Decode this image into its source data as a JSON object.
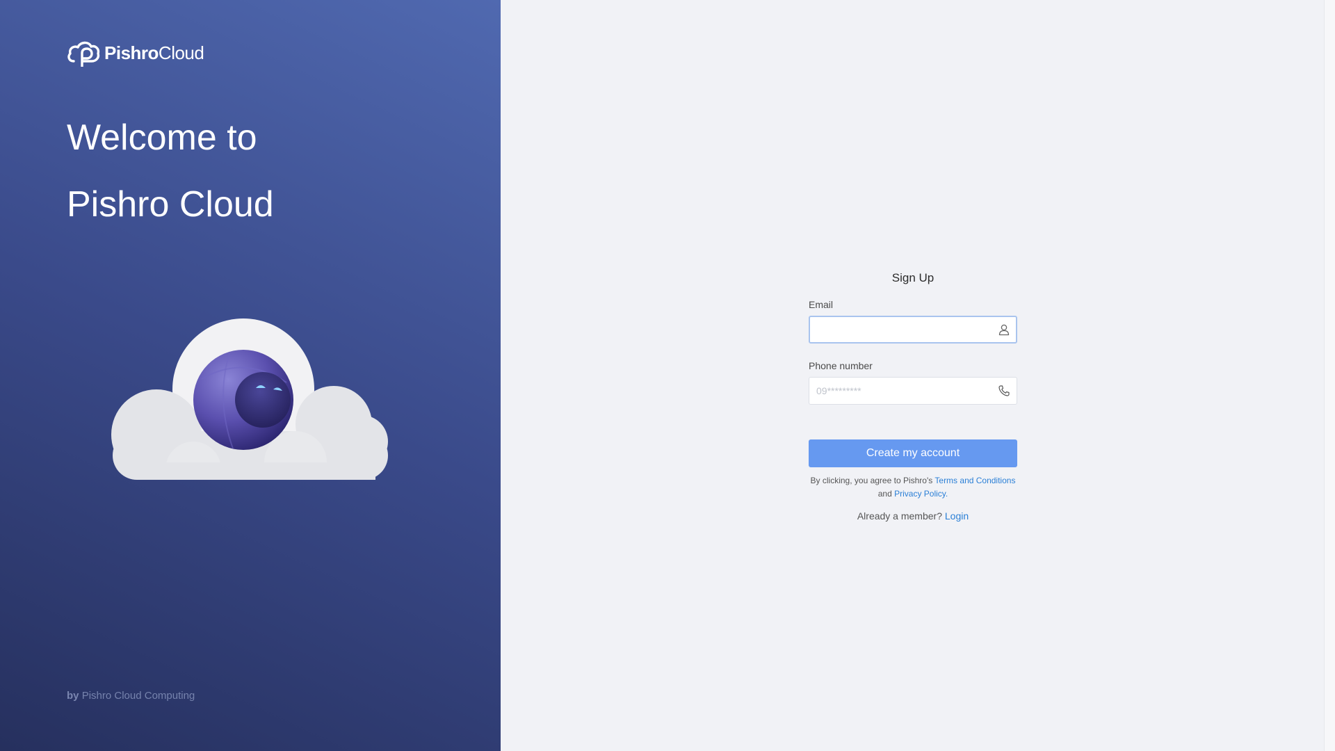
{
  "brand": {
    "logo_icon": "cloud-logo-icon",
    "name_strong": "Pishro",
    "name_light": "Cloud"
  },
  "hero": {
    "welcome_line1": "Welcome to",
    "welcome_line2": "Pishro Cloud",
    "illustration": "cloud-robot-illustration",
    "footer_by": "by",
    "footer_company": "Pishro Cloud Computing"
  },
  "signup": {
    "title": "Sign Up",
    "email": {
      "label": "Email",
      "value": "",
      "placeholder": "",
      "icon": "user-icon"
    },
    "phone": {
      "label": "Phone number",
      "value": "",
      "placeholder": "09*********",
      "icon": "phone-icon"
    },
    "submit_label": "Create my account",
    "terms_prefix": "By clicking, you agree to Pishro's",
    "terms_link": "Terms and Conditions",
    "terms_and": "and",
    "privacy_link": "Privacy Policy",
    "terms_suffix": ".",
    "member_prompt": "Already a member?",
    "login_link": "Login"
  },
  "colors": {
    "hero_gradient_dark": "#26305e",
    "hero_gradient_light": "#5069b0",
    "primary_button": "#6699f0",
    "link": "#2a7fd6",
    "background": "#f1f2f6"
  }
}
